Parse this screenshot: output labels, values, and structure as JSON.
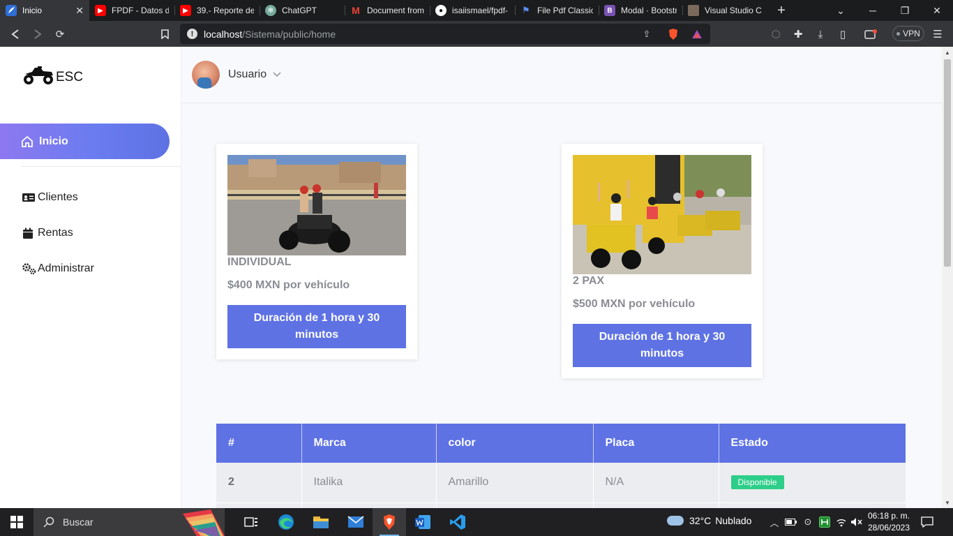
{
  "browser": {
    "tabs": [
      {
        "label": "Inicio",
        "favicon": "app-feather-icon",
        "active": true
      },
      {
        "label": "FPDF - Datos din",
        "favicon": "youtube-icon"
      },
      {
        "label": "39.- Reporte de",
        "favicon": "youtube-icon"
      },
      {
        "label": "ChatGPT",
        "favicon": "chatgpt-icon"
      },
      {
        "label": "Document from",
        "favicon": "gmail-icon"
      },
      {
        "label": "isaiismael/fpdf-",
        "favicon": "github-icon"
      },
      {
        "label": "File Pdf Classic F",
        "favicon": "flag-icon"
      },
      {
        "label": "Modal · Bootstra",
        "favicon": "bootstrap-icon"
      },
      {
        "label": "Visual Studio Co",
        "favicon": "profile-icon"
      }
    ],
    "new_tab_label": "+",
    "url_host": "localhost",
    "url_path": "/Sistema/public/home",
    "vpn_label": "VPN"
  },
  "sidebar": {
    "brand": "ESC",
    "active_item": "Inicio",
    "items": [
      {
        "label": "Clientes",
        "icon": "id-card-icon"
      },
      {
        "label": "Rentas",
        "icon": "calendar-icon"
      },
      {
        "label": "Administrar",
        "icon": "cogs-icon"
      }
    ]
  },
  "topbar": {
    "username": "Usuario"
  },
  "cards": [
    {
      "title": "INDIVIDUAL",
      "price": "$400 MXN por vehículo",
      "button": "Duración de 1 hora y 30 minutos"
    },
    {
      "title": "2 PAX",
      "price": "$500 MXN por vehículo",
      "button": "Duración de 1 hora y 30 minutos"
    }
  ],
  "table": {
    "headers": [
      "#",
      "Marca",
      "color",
      "Placa",
      "Estado"
    ],
    "rows": [
      {
        "num": "2",
        "marca": "Italika",
        "color": "Amarillo",
        "placa": "N/A",
        "estado": "Disponible"
      }
    ]
  },
  "colors": {
    "accent": "#5e72e4",
    "success": "#2dce89",
    "browser_dark": "#35363a"
  },
  "taskbar": {
    "search_label": "Buscar",
    "weather_temp": "32°C",
    "weather_desc": "Nublado",
    "time": "06:18 p. m.",
    "date": "28/06/2023"
  }
}
